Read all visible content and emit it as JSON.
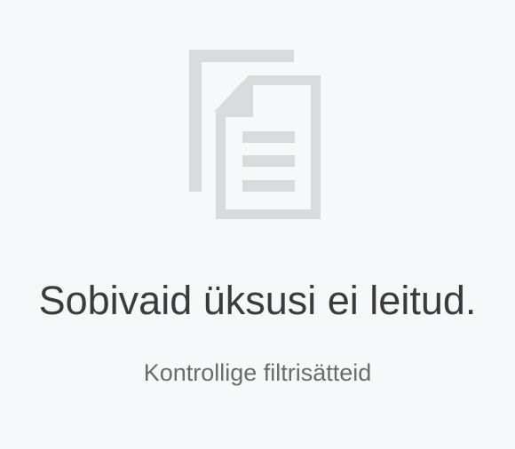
{
  "empty_state": {
    "icon": "documents-icon",
    "title": "Sobivaid üksusi ei leitud.",
    "subtitle": "Kontrollige filtrisätteid"
  },
  "colors": {
    "background": "#f6f8fa",
    "icon": "#d9dbdc",
    "title": "#3b3b3b",
    "subtitle": "#6b6b6b"
  }
}
